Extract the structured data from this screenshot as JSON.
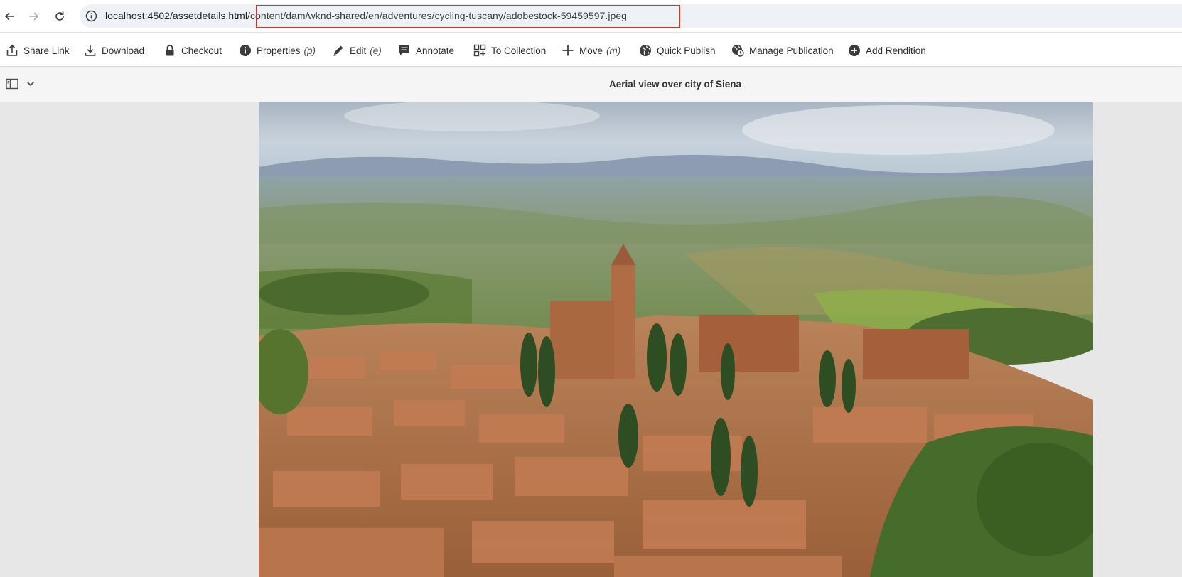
{
  "browser": {
    "url_base": "localhost:4502/assetdetails.html",
    "url_path": "/content/dam/wknd-shared/en/adventures/cycling-tuscany/adobestock-59459597.jpeg"
  },
  "toolbar": {
    "share_link": "Share Link",
    "download": "Download",
    "checkout": "Checkout",
    "properties": "Properties",
    "properties_shortcut": "(p)",
    "edit": "Edit",
    "edit_shortcut": "(e)",
    "annotate": "Annotate",
    "to_collection": "To Collection",
    "move": "Move",
    "move_shortcut": "(m)",
    "quick_publish": "Quick Publish",
    "manage_publication": "Manage Publication",
    "add_rendition": "Add Rendition"
  },
  "asset": {
    "title": "Aerial view over city of Siena"
  },
  "colors": {
    "highlight": "#d93025",
    "address_bg": "#eef1f6",
    "content_bg": "#e7e7e7"
  }
}
